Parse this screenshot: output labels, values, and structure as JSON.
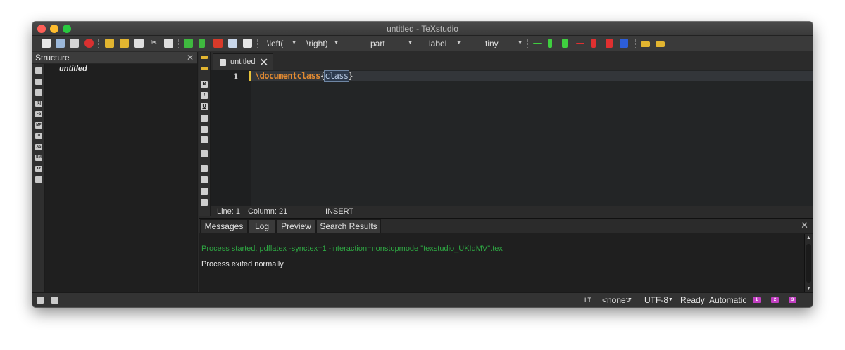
{
  "window": {
    "title": "untitled - TeXstudio"
  },
  "toolbar": {
    "left_combo": "\\left(",
    "right_combo": "\\right)",
    "section_combo": "part",
    "ref_combo": "label",
    "size_combo": "tiny",
    "icons": [
      "new-file-icon",
      "open-file-icon",
      "save-icon",
      "close-file-icon",
      "undo-icon",
      "redo-icon",
      "copy-icon",
      "cut-icon",
      "paste-icon",
      "compile-icon",
      "run-icon",
      "view-pdf-icon",
      "find-icon",
      "spell-icon"
    ]
  },
  "structure": {
    "header": "Structure",
    "close": "✕",
    "root_item": "untitled",
    "side_icons": [
      "",
      "",
      "",
      "{L}",
      "FS",
      "MP",
      "TI",
      "AS",
      "BM",
      "XY",
      ""
    ]
  },
  "editor": {
    "tab_label": "untitled",
    "tab_close": "✕",
    "line_number": "1",
    "code_keyword": "\\documentclass",
    "code_open": "{",
    "code_arg": "class",
    "code_close": "}",
    "left_icons": [
      "B",
      "I",
      "U"
    ]
  },
  "status_line": {
    "line": "Line: 1",
    "column": "Column: 21",
    "mode": "INSERT"
  },
  "bottom_panel": {
    "tabs": [
      "Messages",
      "Log",
      "Preview",
      "Search Results"
    ],
    "active_tab": "Messages",
    "close": "✕",
    "messages": [
      "Process started: pdflatex -synctex=1 -interaction=nonstopmode \"texstudio_UKIdMV\".tex",
      "Process exited normally"
    ]
  },
  "statusbar": {
    "lt": "LT",
    "language": "<none>",
    "encoding": "UTF-8",
    "status": "Ready",
    "mode": "Automatic",
    "bookmarks": [
      "1",
      "2",
      "3"
    ]
  },
  "colors": {
    "keyword": "#e38b32",
    "message_ok": "#2ea843",
    "bookmark": "#c23fc2"
  }
}
